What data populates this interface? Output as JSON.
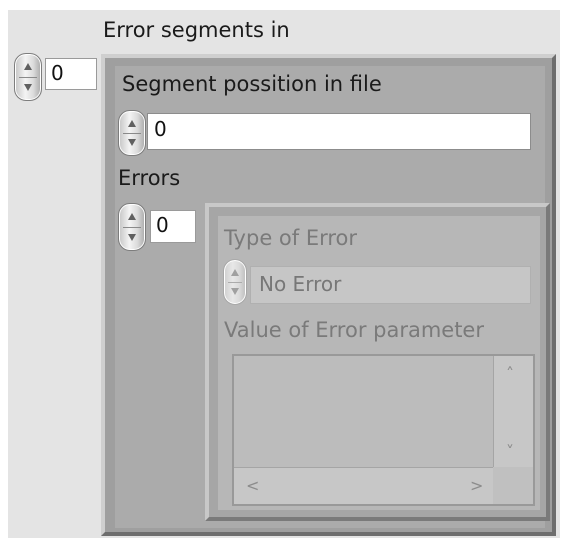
{
  "error_segments_in": {
    "label": "Error segments in",
    "index_value": "0",
    "segment_position": {
      "label": "Segment possition in file",
      "value": "0"
    },
    "errors": {
      "label": "Errors",
      "index_value": "0",
      "type_of_error": {
        "label": "Type of Error",
        "selected": "No Error"
      },
      "value_of_error_parameter": {
        "label": "Value of Error parameter",
        "items": []
      }
    }
  },
  "icons": {
    "spinner": "increment-decrement-arrows",
    "scroll_up": "chevron-up-icon",
    "scroll_down": "chevron-down-icon",
    "scroll_left": "chevron-left-icon",
    "scroll_right": "chevron-right-icon"
  },
  "colors": {
    "cluster_background": "#e4e4e4",
    "frame": "#9f9f9f",
    "disabled_text": "#7a7a7a"
  }
}
